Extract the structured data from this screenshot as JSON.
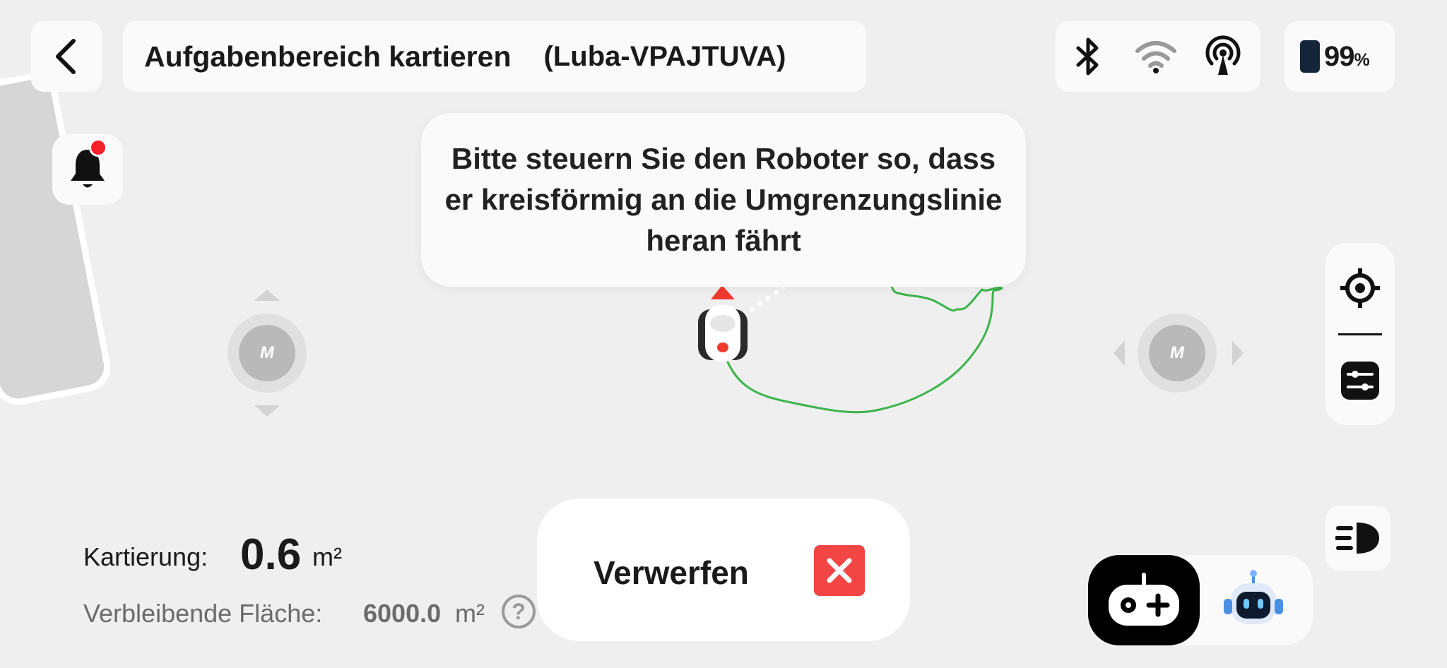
{
  "header": {
    "back_icon": "chevron-left-icon",
    "title": "Aufgabenbereich kartieren",
    "device": "(Luba-VPAJTUVA)",
    "status_icons": [
      "bluetooth-icon",
      "wifi-icon",
      "cellular-antenna-icon"
    ],
    "battery": {
      "value": "99",
      "unit": "%"
    }
  },
  "notification": {
    "icon": "bell-icon",
    "has_unread": true
  },
  "tooltip": {
    "text": "Bitte steuern Sie den Roboter so, dass er kreisförmig an die Umgrenzungslinie heran fährt"
  },
  "joysticks": {
    "left": {
      "logo": "M",
      "direction": "vertical"
    },
    "right": {
      "logo": "M",
      "direction": "horizontal"
    }
  },
  "toolbar": {
    "items": [
      "locate-crosshair-icon",
      "settings-sliders-icon"
    ],
    "light_icon": "headlight-icon"
  },
  "stats": {
    "mapping_label": "Kartierung:",
    "mapping_value": "0.6",
    "mapping_unit": "m²",
    "remaining_label": "Verbleibende Fläche:",
    "remaining_value": "6000.0",
    "remaining_unit": "m²",
    "help_icon": "?"
  },
  "discard": {
    "label": "Verwerfen",
    "icon": "close-icon"
  },
  "modes": {
    "manual": "gamepad-icon",
    "assistant": "robot-assistant-icon"
  },
  "colors": {
    "path": "#3cb44b",
    "alert": "#f44545",
    "notification_dot": "#f4232a"
  }
}
